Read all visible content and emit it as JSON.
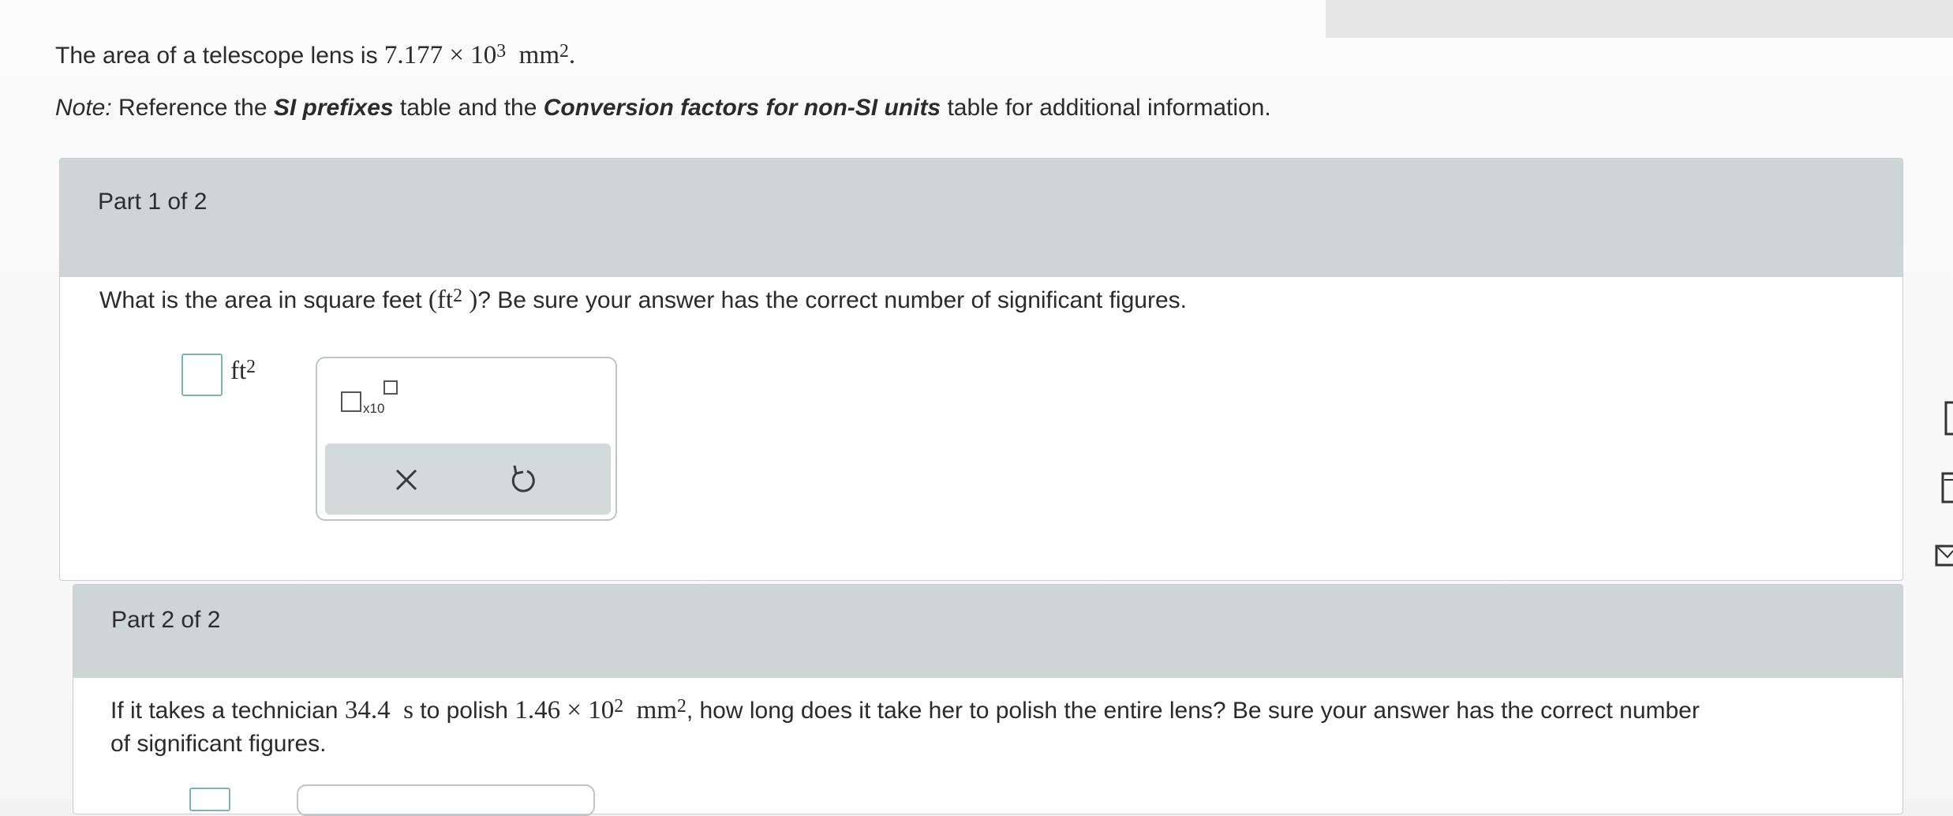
{
  "intro": {
    "lead": "The area of a telescope lens is ",
    "mantissa": "7.177",
    "times": "×",
    "base": "10",
    "exponent": "3",
    "unit": "mm",
    "unit_power": "2",
    "period": "."
  },
  "note": {
    "label": "Note:",
    "text1": " Reference the ",
    "bold1": "SI prefixes",
    "text2": " table and the ",
    "bold2": "Conversion factors for non-SI units",
    "text3": " table for additional information."
  },
  "part1": {
    "title": "Part 1 of 2",
    "question_lead": "What is the area in square feet ",
    "question_unit": "(ft",
    "question_unit_power": "2",
    "question_unit_close": ")",
    "question_tail": "? Be sure your answer has the correct number of significant figures.",
    "answer_value": "",
    "answer_unit": "ft",
    "answer_unit_power": "2",
    "toolbox": {
      "sci_notation_label": "x10",
      "clear_icon": "close-icon",
      "undo_icon": "undo-icon"
    }
  },
  "part2": {
    "title": "Part 2 of 2",
    "question_lead": "If it takes a technician ",
    "time_value": "34.4",
    "time_unit": "s",
    "mid": " to polish ",
    "mantissa": "1.46",
    "times": "×",
    "base": "10",
    "exponent": "2",
    "unit": "mm",
    "unit_power": "2",
    "question_tail": ", how long does it take her to polish the entire lens? Be sure your answer has the correct number",
    "question_tail2": "of significant figures."
  },
  "colors": {
    "header_bg": "#cdd5d5",
    "answer_border": "#7cb6ab",
    "toolbar_bg": "#d4d9d9"
  }
}
